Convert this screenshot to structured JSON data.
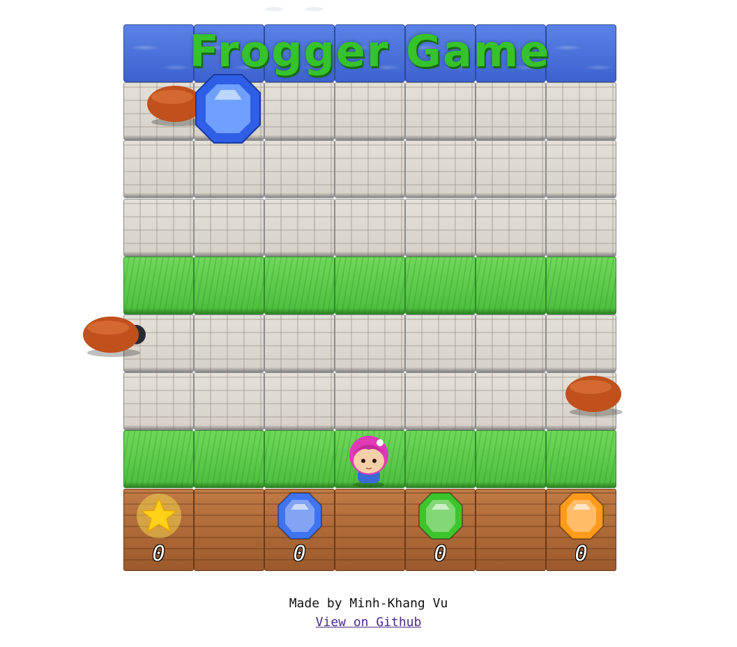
{
  "title": "Frogger Game",
  "rows": [
    "water",
    "stone",
    "stone",
    "stone",
    "grass",
    "stone",
    "stone",
    "grass",
    "dirt"
  ],
  "columns": 7,
  "collectibles": [
    {
      "icon": "star-icon",
      "color": "#ffd21a",
      "count": "0"
    },
    {
      "icon": "blue-gem-icon",
      "color": "#3f73f0",
      "count": "0"
    },
    {
      "icon": "green-gem-icon",
      "color": "#3ec42c",
      "count": "0"
    },
    {
      "icon": "orange-gem-icon",
      "color": "#ff9a1a",
      "count": "0"
    }
  ],
  "footer": {
    "credit": "Made by Minh-Khang Vu",
    "github_link": "View on Github"
  }
}
